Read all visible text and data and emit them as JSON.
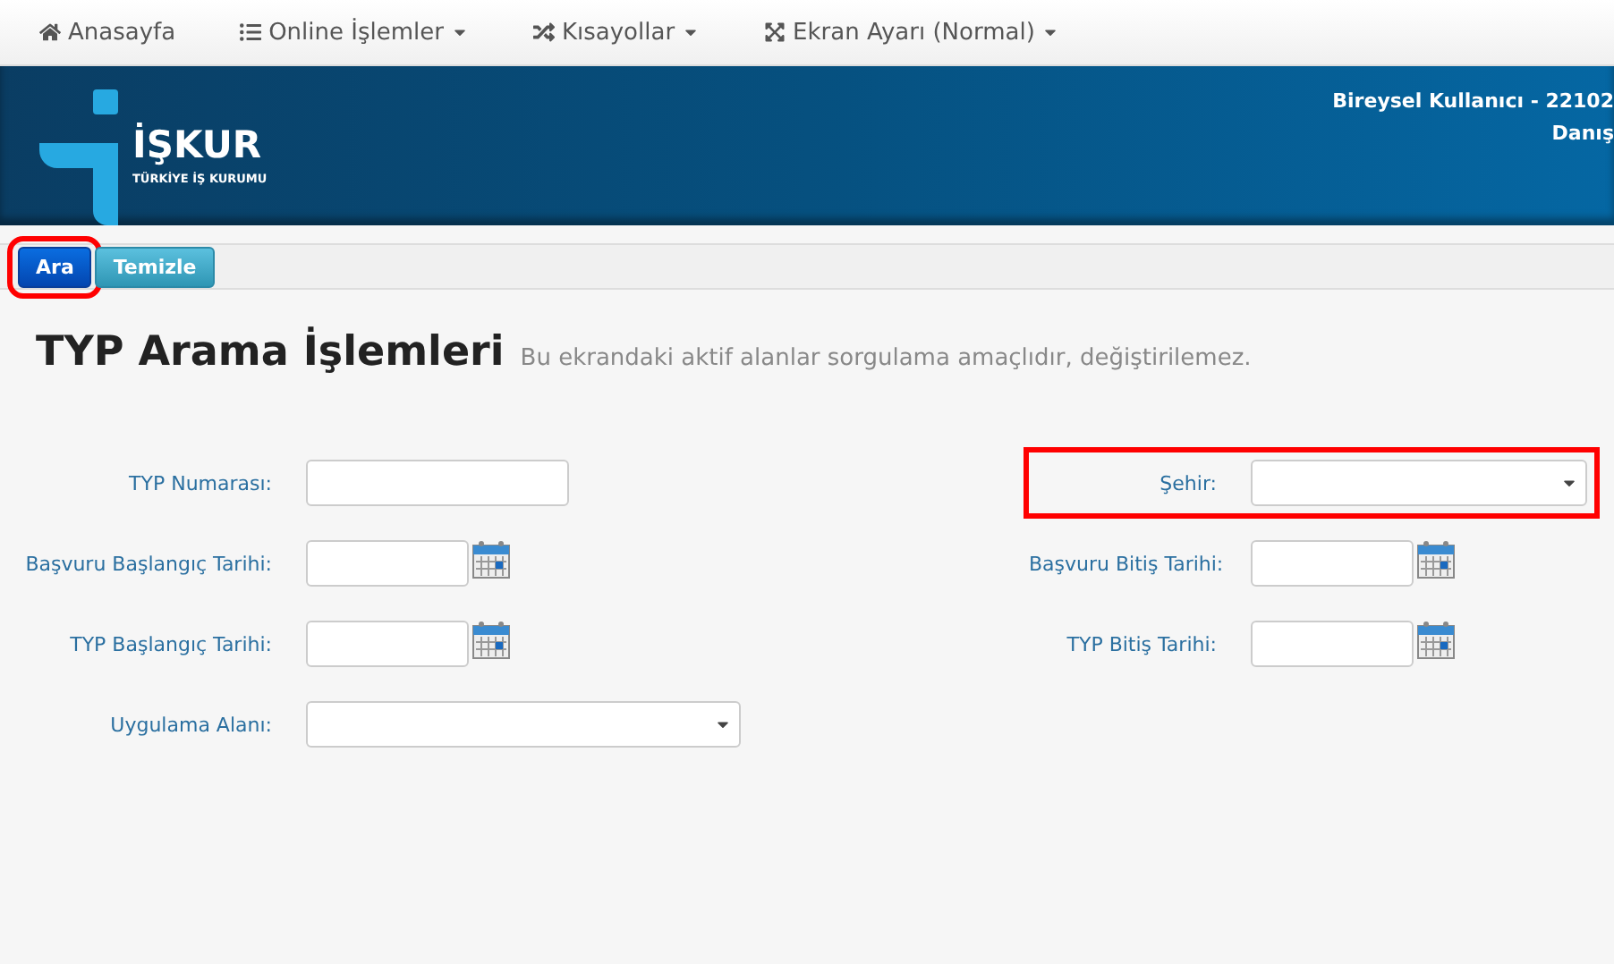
{
  "nav": [
    {
      "label": "Anasayfa",
      "dropdown": false
    },
    {
      "label": "Online İşlemler",
      "dropdown": true
    },
    {
      "label": "Kısayollar",
      "dropdown": true
    },
    {
      "label": "Ekran Ayarı (Normal)",
      "dropdown": true
    }
  ],
  "header": {
    "logo_name": "İŞKUR",
    "logo_subtitle": "TÜRKİYE İŞ KURUMU",
    "user_line": "Bireysel Kullanıcı - 22102",
    "user_sub": "Danış"
  },
  "toolbar": [
    {
      "label": "Ara",
      "kind": "primary",
      "highlighted": true
    },
    {
      "label": "Temizle",
      "kind": "info",
      "highlighted": false
    }
  ],
  "page": {
    "title": "TYP Arama İşlemleri",
    "subtitle": "Bu ekrandaki aktif alanlar sorgulama amaçlıdır, değiştirilemez."
  },
  "form_rows": [
    {
      "left": {
        "label": "TYP Numarası:",
        "kind": "text",
        "highlighted": false
      },
      "right": {
        "label": "Şehir:",
        "kind": "select",
        "highlighted": true
      }
    },
    {
      "left": {
        "label": "Başvuru Başlangıç Tarihi:",
        "kind": "date",
        "highlighted": false
      },
      "right": {
        "label": "Başvuru Bitiş Tarihi:",
        "kind": "date",
        "highlighted": false
      }
    },
    {
      "left": {
        "label": "TYP Başlangıç Tarihi:",
        "kind": "date",
        "highlighted": false
      },
      "right": {
        "label": "TYP Bitiş Tarihi:",
        "kind": "date",
        "highlighted": false
      }
    },
    {
      "left": {
        "label": "Uygulama Alanı:",
        "kind": "wideselect",
        "highlighted": false
      }
    }
  ]
}
